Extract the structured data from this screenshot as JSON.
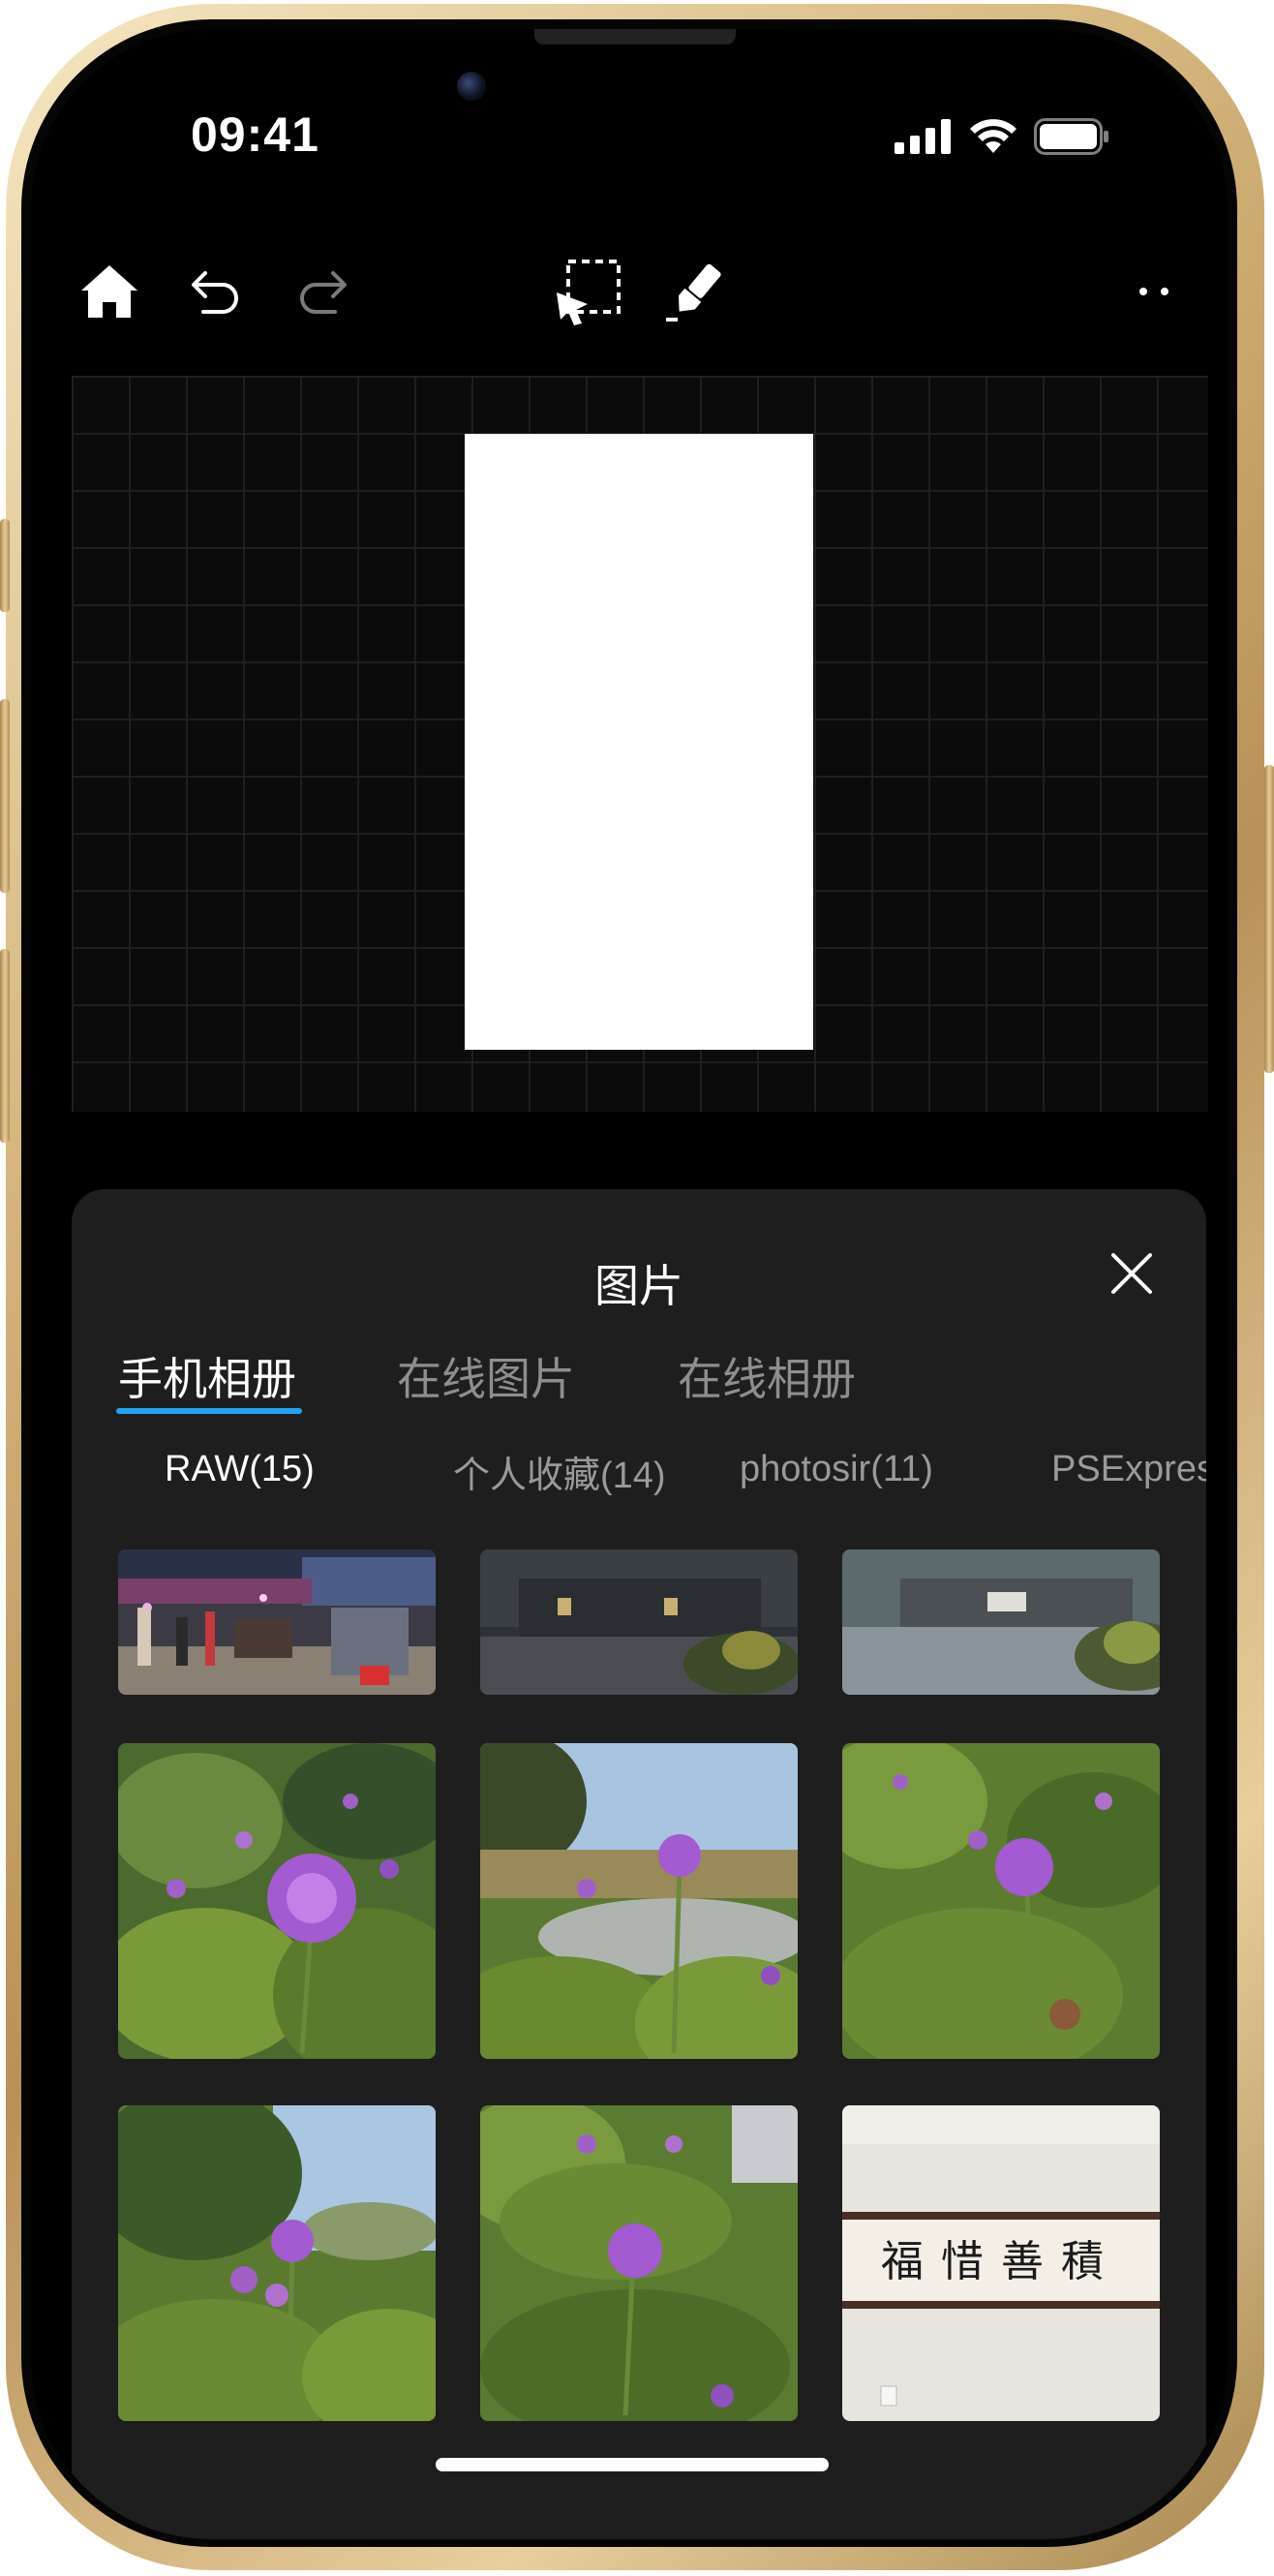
{
  "status_bar": {
    "time": "09:41"
  },
  "toolbar": {
    "items": [
      "home-icon",
      "undo-icon",
      "redo-icon",
      "selection-icon",
      "brush-icon",
      "more-icon"
    ]
  },
  "sheet": {
    "title": "图片",
    "tabs": [
      {
        "label": "手机相册",
        "active": true
      },
      {
        "label": "在线图片",
        "active": false
      },
      {
        "label": "在线相册",
        "active": false
      }
    ],
    "albums": [
      {
        "label": "RAW(15)",
        "active": true
      },
      {
        "label": "个人收藏(14)",
        "active": false
      },
      {
        "label": "photosir(11)",
        "active": false
      },
      {
        "label": "PSExpress",
        "active": false
      }
    ],
    "photos": [
      {
        "kind": "night-market"
      },
      {
        "kind": "dark-building"
      },
      {
        "kind": "building-plaza"
      },
      {
        "kind": "purple-flower"
      },
      {
        "kind": "purple-flower-sky"
      },
      {
        "kind": "purple-flower"
      },
      {
        "kind": "purple-flower-sky"
      },
      {
        "kind": "purple-flower"
      },
      {
        "kind": "calligraphy",
        "text": "福惜善積"
      }
    ]
  },
  "colors": {
    "accent": "#20a4f3",
    "sheet_bg": "#1e1e1e",
    "frame_gold": "#d6b77e"
  }
}
